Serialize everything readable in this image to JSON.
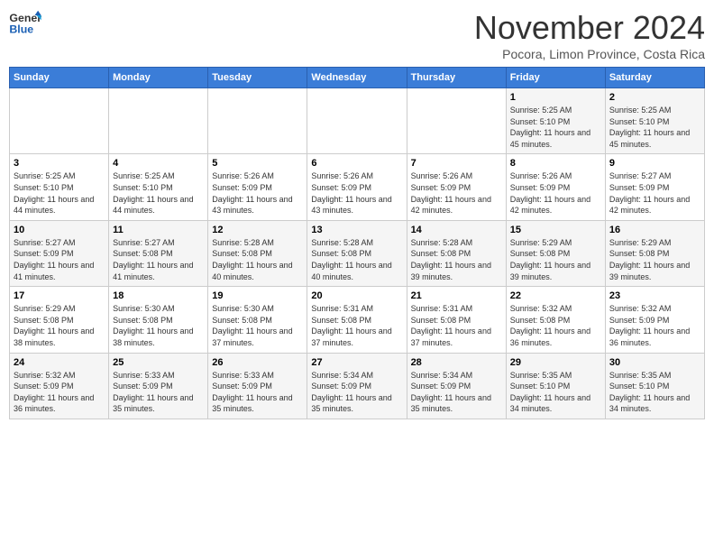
{
  "header": {
    "logo_line1": "General",
    "logo_line2": "Blue",
    "month_title": "November 2024",
    "location": "Pocora, Limon Province, Costa Rica"
  },
  "weekdays": [
    "Sunday",
    "Monday",
    "Tuesday",
    "Wednesday",
    "Thursday",
    "Friday",
    "Saturday"
  ],
  "weeks": [
    [
      {
        "day": "",
        "info": ""
      },
      {
        "day": "",
        "info": ""
      },
      {
        "day": "",
        "info": ""
      },
      {
        "day": "",
        "info": ""
      },
      {
        "day": "",
        "info": ""
      },
      {
        "day": "1",
        "info": "Sunrise: 5:25 AM\nSunset: 5:10 PM\nDaylight: 11 hours and 45 minutes."
      },
      {
        "day": "2",
        "info": "Sunrise: 5:25 AM\nSunset: 5:10 PM\nDaylight: 11 hours and 45 minutes."
      }
    ],
    [
      {
        "day": "3",
        "info": "Sunrise: 5:25 AM\nSunset: 5:10 PM\nDaylight: 11 hours and 44 minutes."
      },
      {
        "day": "4",
        "info": "Sunrise: 5:25 AM\nSunset: 5:10 PM\nDaylight: 11 hours and 44 minutes."
      },
      {
        "day": "5",
        "info": "Sunrise: 5:26 AM\nSunset: 5:09 PM\nDaylight: 11 hours and 43 minutes."
      },
      {
        "day": "6",
        "info": "Sunrise: 5:26 AM\nSunset: 5:09 PM\nDaylight: 11 hours and 43 minutes."
      },
      {
        "day": "7",
        "info": "Sunrise: 5:26 AM\nSunset: 5:09 PM\nDaylight: 11 hours and 42 minutes."
      },
      {
        "day": "8",
        "info": "Sunrise: 5:26 AM\nSunset: 5:09 PM\nDaylight: 11 hours and 42 minutes."
      },
      {
        "day": "9",
        "info": "Sunrise: 5:27 AM\nSunset: 5:09 PM\nDaylight: 11 hours and 42 minutes."
      }
    ],
    [
      {
        "day": "10",
        "info": "Sunrise: 5:27 AM\nSunset: 5:09 PM\nDaylight: 11 hours and 41 minutes."
      },
      {
        "day": "11",
        "info": "Sunrise: 5:27 AM\nSunset: 5:08 PM\nDaylight: 11 hours and 41 minutes."
      },
      {
        "day": "12",
        "info": "Sunrise: 5:28 AM\nSunset: 5:08 PM\nDaylight: 11 hours and 40 minutes."
      },
      {
        "day": "13",
        "info": "Sunrise: 5:28 AM\nSunset: 5:08 PM\nDaylight: 11 hours and 40 minutes."
      },
      {
        "day": "14",
        "info": "Sunrise: 5:28 AM\nSunset: 5:08 PM\nDaylight: 11 hours and 39 minutes."
      },
      {
        "day": "15",
        "info": "Sunrise: 5:29 AM\nSunset: 5:08 PM\nDaylight: 11 hours and 39 minutes."
      },
      {
        "day": "16",
        "info": "Sunrise: 5:29 AM\nSunset: 5:08 PM\nDaylight: 11 hours and 39 minutes."
      }
    ],
    [
      {
        "day": "17",
        "info": "Sunrise: 5:29 AM\nSunset: 5:08 PM\nDaylight: 11 hours and 38 minutes."
      },
      {
        "day": "18",
        "info": "Sunrise: 5:30 AM\nSunset: 5:08 PM\nDaylight: 11 hours and 38 minutes."
      },
      {
        "day": "19",
        "info": "Sunrise: 5:30 AM\nSunset: 5:08 PM\nDaylight: 11 hours and 37 minutes."
      },
      {
        "day": "20",
        "info": "Sunrise: 5:31 AM\nSunset: 5:08 PM\nDaylight: 11 hours and 37 minutes."
      },
      {
        "day": "21",
        "info": "Sunrise: 5:31 AM\nSunset: 5:08 PM\nDaylight: 11 hours and 37 minutes."
      },
      {
        "day": "22",
        "info": "Sunrise: 5:32 AM\nSunset: 5:08 PM\nDaylight: 11 hours and 36 minutes."
      },
      {
        "day": "23",
        "info": "Sunrise: 5:32 AM\nSunset: 5:09 PM\nDaylight: 11 hours and 36 minutes."
      }
    ],
    [
      {
        "day": "24",
        "info": "Sunrise: 5:32 AM\nSunset: 5:09 PM\nDaylight: 11 hours and 36 minutes."
      },
      {
        "day": "25",
        "info": "Sunrise: 5:33 AM\nSunset: 5:09 PM\nDaylight: 11 hours and 35 minutes."
      },
      {
        "day": "26",
        "info": "Sunrise: 5:33 AM\nSunset: 5:09 PM\nDaylight: 11 hours and 35 minutes."
      },
      {
        "day": "27",
        "info": "Sunrise: 5:34 AM\nSunset: 5:09 PM\nDaylight: 11 hours and 35 minutes."
      },
      {
        "day": "28",
        "info": "Sunrise: 5:34 AM\nSunset: 5:09 PM\nDaylight: 11 hours and 35 minutes."
      },
      {
        "day": "29",
        "info": "Sunrise: 5:35 AM\nSunset: 5:10 PM\nDaylight: 11 hours and 34 minutes."
      },
      {
        "day": "30",
        "info": "Sunrise: 5:35 AM\nSunset: 5:10 PM\nDaylight: 11 hours and 34 minutes."
      }
    ]
  ]
}
